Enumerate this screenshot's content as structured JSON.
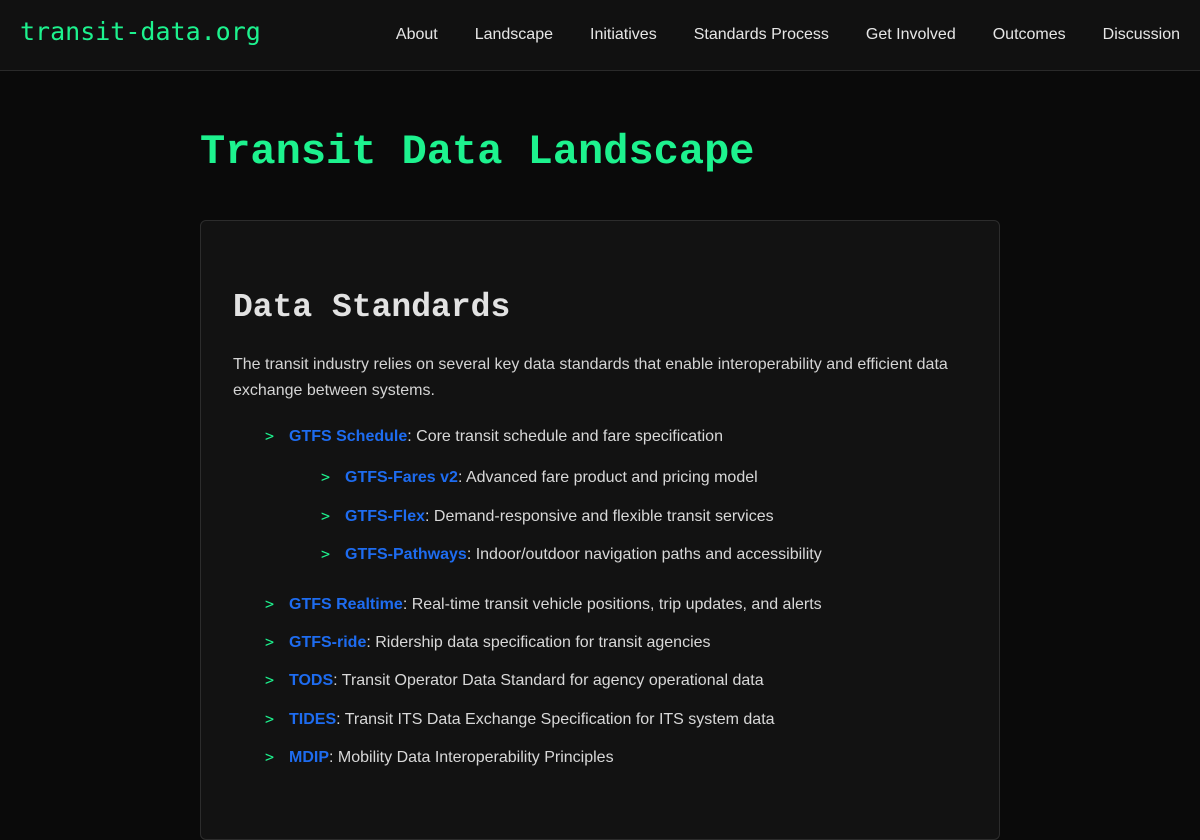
{
  "site": {
    "brand": "transit-data.org",
    "nav": [
      {
        "label": "About"
      },
      {
        "label": "Landscape"
      },
      {
        "label": "Initiatives"
      },
      {
        "label": "Standards Process"
      },
      {
        "label": "Get Involved"
      },
      {
        "label": "Outcomes"
      },
      {
        "label": "Discussion"
      }
    ]
  },
  "page": {
    "title": "Transit Data Landscape"
  },
  "section": {
    "title": "Data Standards",
    "intro": "The transit industry relies on several key data standards that enable interoperability and efficient data exchange between systems.",
    "marker": ">",
    "standards": [
      {
        "name": "GTFS Schedule",
        "desc": ": Core transit schedule and fare specification"
      },
      {
        "name": "GTFS-Fares v2",
        "desc": ": Advanced fare product and pricing model"
      },
      {
        "name": "GTFS-Flex",
        "desc": ": Demand-responsive and flexible transit services"
      },
      {
        "name": "GTFS-Pathways",
        "desc": ": Indoor/outdoor navigation paths and accessibility"
      },
      {
        "name": "GTFS Realtime",
        "desc": ": Real-time transit vehicle positions, trip updates, and alerts"
      },
      {
        "name": "GTFS-ride",
        "desc": ": Ridership data specification for transit agencies"
      },
      {
        "name": "TODS",
        "desc": ": Transit Operator Data Standard for agency operational data"
      },
      {
        "name": "TIDES",
        "desc": ": Transit ITS Data Exchange Specification for ITS system data"
      },
      {
        "name": "MDIP",
        "desc": ": Mobility Data Interoperability Principles"
      }
    ]
  },
  "colors": {
    "accent": "#1df28e",
    "link": "#1e6cf0",
    "background": "#0a0a0a",
    "card": "#121212"
  }
}
